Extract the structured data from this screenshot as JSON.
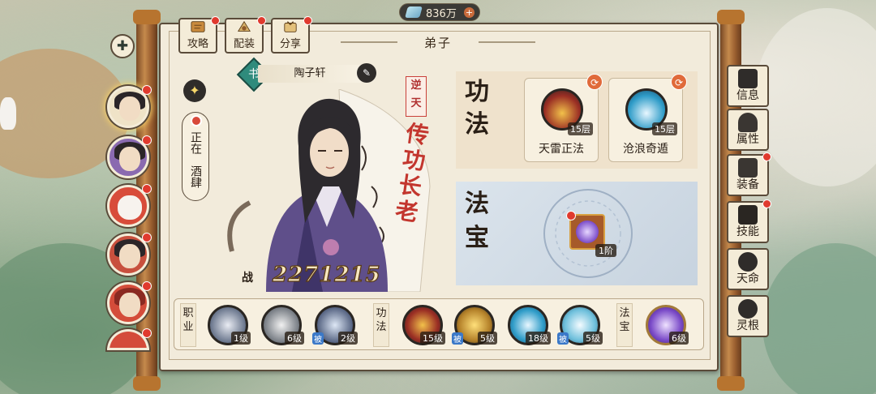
{
  "currency": {
    "icon": "spirit-stone-icon",
    "amount": "836万",
    "add_label": "+"
  },
  "top_tabs": [
    {
      "label": "攻略",
      "icon": "guide-scroll-icon",
      "badge": true
    },
    {
      "label": "配装",
      "icon": "equipment-setup-icon",
      "badge": true
    },
    {
      "label": "分享",
      "icon": "share-icon",
      "badge": true
    }
  ],
  "section_title": "弟子",
  "disciple": {
    "name": "陶子轩",
    "name_badge_char": "书",
    "tag": [
      "逆",
      "天"
    ],
    "title_calligraphy": "传功长老",
    "status_line1": "正在",
    "status_line2": "酒肆",
    "power_label": "战",
    "power_value": "2271215"
  },
  "panels": {
    "gongfa_title": [
      "功",
      "法"
    ],
    "fabao_title": [
      "法",
      "宝"
    ]
  },
  "skills": [
    {
      "name": "天雷正法",
      "level": "15层",
      "icon": "thunder-sword-icon"
    },
    {
      "name": "沧浪奇遁",
      "level": "15层",
      "icon": "wave-icon"
    }
  ],
  "treasure": {
    "level": "1阶",
    "icon": "purple-orb-icon"
  },
  "bottom_bar": {
    "labels": [
      "职业",
      "功法",
      "法宝"
    ],
    "slots": [
      {
        "icon": "brush-icon",
        "level": "1级",
        "passive": ""
      },
      {
        "icon": "shovel-icon",
        "level": "6级",
        "passive": ""
      },
      {
        "icon": "furnace-icon",
        "level": "2级",
        "passive": "被"
      },
      {
        "icon": "thunder-sword-icon",
        "level": "15级",
        "passive": ""
      },
      {
        "icon": "golden-dragon-icon",
        "level": "5级",
        "passive": "被"
      },
      {
        "icon": "wave-icon",
        "level": "18级",
        "passive": ""
      },
      {
        "icon": "ice-wave-icon",
        "level": "5级",
        "passive": "被"
      },
      {
        "icon": "purple-orb-icon",
        "level": "6级",
        "passive": ""
      }
    ]
  },
  "side_tabs": [
    {
      "label": "信息",
      "icon": "info-book-icon",
      "badge": false
    },
    {
      "label": "属性",
      "icon": "figure-icon",
      "badge": false
    },
    {
      "label": "装备",
      "icon": "bag-icon",
      "badge": true
    },
    {
      "label": "技能",
      "icon": "skill-book-icon",
      "badge": true
    },
    {
      "label": "天命",
      "icon": "fate-swirl-icon",
      "badge": false
    },
    {
      "label": "灵根",
      "icon": "root-eye-icon",
      "badge": false
    }
  ],
  "colors": {
    "accent_red": "#e03a2e",
    "paper": "#f2ebdb",
    "ink": "#2a1f16"
  }
}
